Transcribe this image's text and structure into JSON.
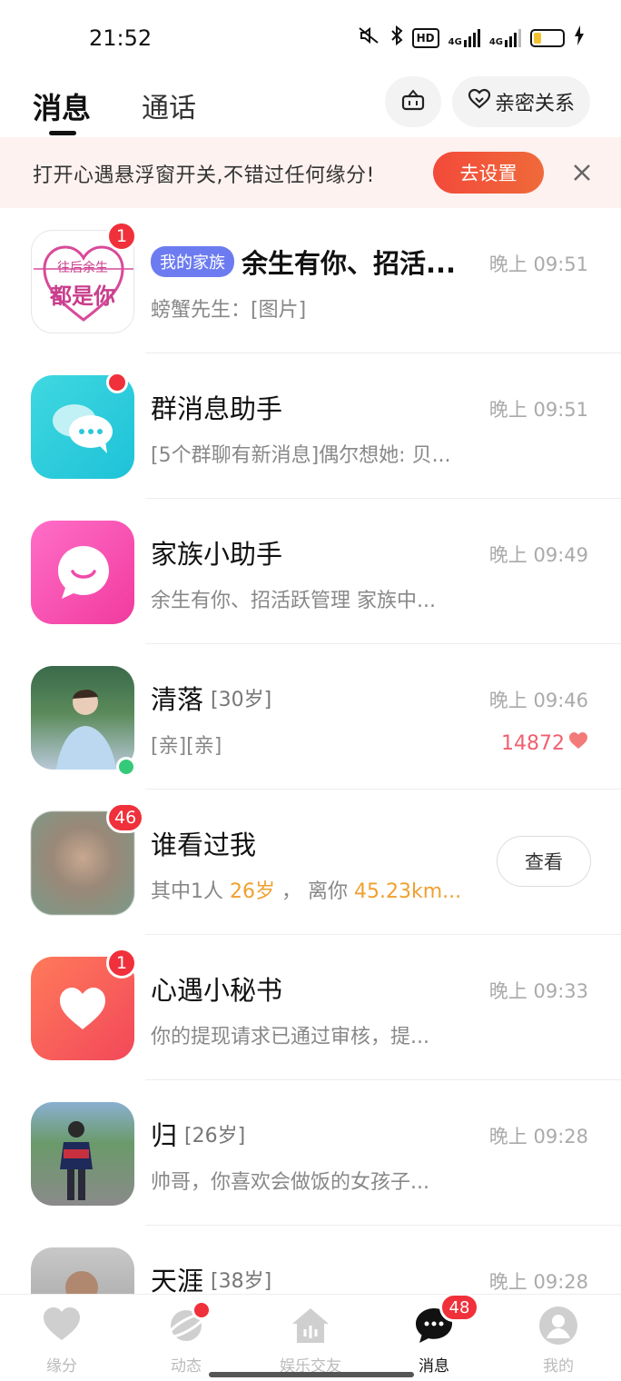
{
  "status_bar": {
    "time": "21:52",
    "hd": "HD",
    "net1": "4G",
    "net2": "4G"
  },
  "header": {
    "tabs": [
      "消息",
      "通话"
    ],
    "intimacy_label": "亲密关系"
  },
  "banner": {
    "text": "打开心遇悬浮窗开关,不错过任何缘分!",
    "button_label": "去设置"
  },
  "messages": [
    {
      "tag": "我的家族",
      "name": "余生有你、招活...",
      "time": "晚上 09:51",
      "preview": "螃蟹先生：[图片]",
      "badge": "1",
      "avatar_text_top": "往后余生",
      "avatar_text_main": "都是你"
    },
    {
      "name": "群消息助手",
      "time": "晚上 09:51",
      "preview": "[5个群聊有新消息]偶尔想她: 贝..."
    },
    {
      "name": "家族小助手",
      "time": "晚上 09:49",
      "preview": "余生有你、招活跃管理 家族中..."
    },
    {
      "name": "清落",
      "age": "[30岁]",
      "time": "晚上 09:46",
      "preview": "[亲][亲]",
      "intimacy": "14872"
    },
    {
      "name": "谁看过我",
      "badge": "46",
      "preview_prefix": "其中1人 ",
      "preview_age": "26岁",
      "preview_mid": " ， 离你 ",
      "preview_dist": "45.23km...",
      "button_label": "查看"
    },
    {
      "name": "心遇小秘书",
      "badge": "1",
      "time": "晚上 09:33",
      "preview": "你的提现请求已通过审核，提..."
    },
    {
      "name": "归",
      "age": "[26岁]",
      "time": "晚上 09:28",
      "preview": "帅哥，你喜欢会做饭的女孩子..."
    },
    {
      "name": "天涯",
      "age": "[38岁]",
      "time": "晚上 09:28"
    }
  ],
  "bottom_nav": {
    "items": [
      "缘分",
      "动态",
      "娱乐交友",
      "消息",
      "我的"
    ],
    "messages_badge": "48"
  },
  "colors": {
    "accent_red": "#f0303a",
    "banner_bg": "#fdf2f0",
    "family_tag": "#6c7cf0",
    "highlight_orange": "#f0a030",
    "online_green": "#35c97a"
  }
}
